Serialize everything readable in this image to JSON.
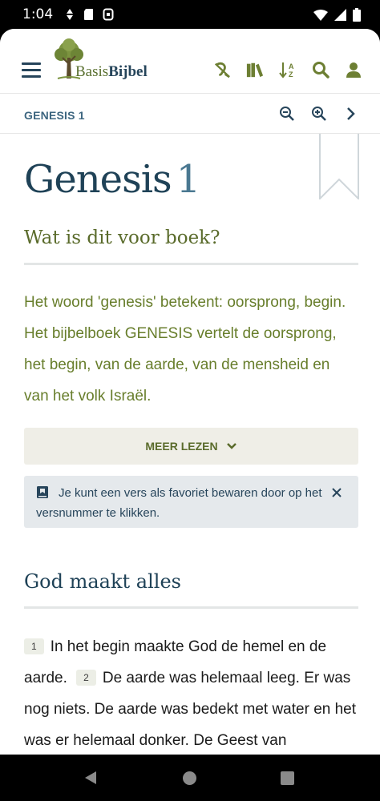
{
  "status": {
    "time": "1:04",
    "left_icons": [
      "data-saver-icon",
      "sd-card-icon",
      "notification-icon"
    ],
    "right_icons": [
      "wifi-icon",
      "cell-signal-icon",
      "battery-icon"
    ]
  },
  "app": {
    "logo": {
      "part1": "Basis",
      "part2": "Bijbel"
    },
    "toolbar_icons": [
      "no-audio-icon",
      "library-icon",
      "sort-icon",
      "search-icon",
      "user-icon"
    ]
  },
  "subbar": {
    "breadcrumb": "GENESIS 1",
    "icons": [
      "zoom-out-icon",
      "zoom-in-icon",
      "chevron-right-icon"
    ]
  },
  "chapter": {
    "book": "Genesis",
    "number": "1"
  },
  "intro": {
    "heading": "Wat is dit voor boek?",
    "text": "Het woord 'genesis' betekent: oorsprong, begin. Het bijbelboek GENESIS vertelt de oorsprong, het begin, van de aarde, van de mensheid en van het volk Israël.",
    "more_label": "MEER LEZEN"
  },
  "notice": {
    "text": "Je kunt een vers als favoriet bewaren door op het versnummer te klikken."
  },
  "section": {
    "heading": "God maakt alles",
    "verses": [
      {
        "num": "1",
        "text": "In het begin maakte God de hemel en de aarde."
      },
      {
        "num": "2",
        "text": "De aarde was helemaal leeg. Er was nog niets. De aarde was bedekt met water en het was er helemaal donker. De Geest van"
      }
    ]
  },
  "colors": {
    "navy": "#1f4257",
    "olive": "#687e2c",
    "notice_bg": "#e5e9ec",
    "button_bg": "#efeee7"
  }
}
